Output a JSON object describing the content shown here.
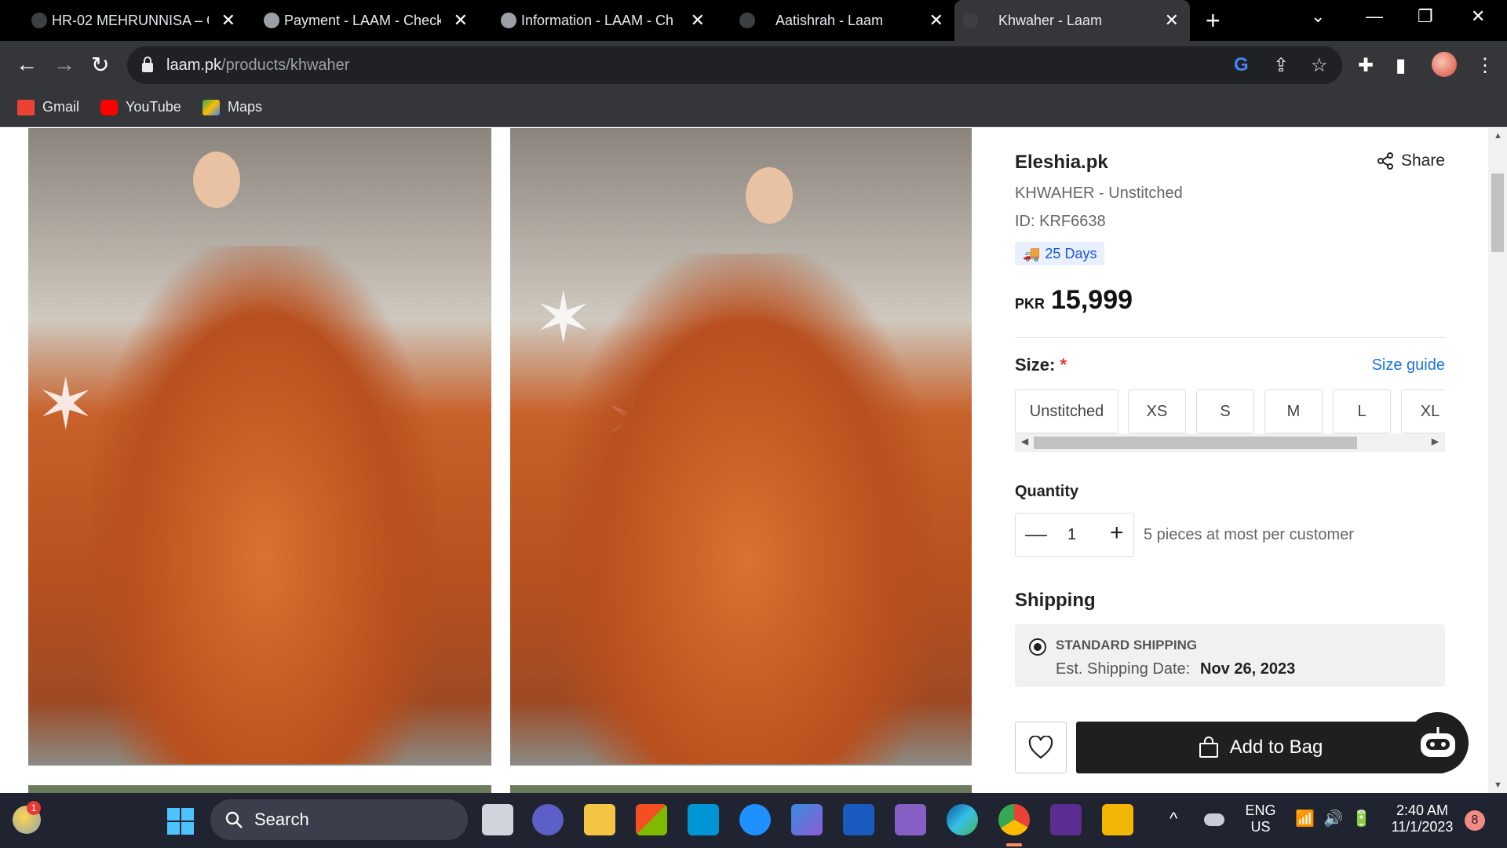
{
  "browser": {
    "tabs": [
      {
        "title": "HR-02 MEHRUNNISA – C",
        "color": "#3c4043"
      },
      {
        "title": "Payment - LAAM - Check",
        "color": "#5f6368"
      },
      {
        "title": "Information - LAAM - Ch",
        "color": "#5f6368"
      },
      {
        "title": "Aatishrah - Laam",
        "color": "#3c4043"
      },
      {
        "title": "Khwaher - Laam",
        "color": "#3c4043"
      }
    ],
    "tab_close": "✕",
    "new_tab": "+",
    "url_host": "laam.pk",
    "url_path": "/products/khwaher",
    "bookmarks": [
      {
        "label": "Gmail",
        "icon": "gmail-icon",
        "color": "#ea4335"
      },
      {
        "label": "YouTube",
        "icon": "youtube-icon",
        "color": "#ff0000"
      },
      {
        "label": "Maps",
        "icon": "maps-icon",
        "color": "#34a853"
      }
    ]
  },
  "product": {
    "brand": "Eleshia.pk",
    "share_label": "Share",
    "subtitle": "KHWAHER - Unstitched",
    "id_text": "ID: KRF6638",
    "delivery_badge": "25 Days",
    "currency": "PKR",
    "price": "15,999",
    "size_label": "Size:",
    "required_mark": "*",
    "size_guide": "Size guide",
    "sizes": [
      "Unstitched",
      "XS",
      "S",
      "M",
      "L",
      "XL"
    ],
    "quantity_label": "Quantity",
    "quantity_value": "1",
    "quantity_note": "5 pieces at most per customer",
    "shipping_label": "Shipping",
    "shipping_option": "STANDARD SHIPPING",
    "shipping_date_label": "Est. Shipping Date:",
    "shipping_date": "Nov 26, 2023",
    "add_to_bag": "Add to Bag"
  },
  "taskbar": {
    "search_placeholder": "Search",
    "weather_badge": "1",
    "lang_top": "ENG",
    "lang_bottom": "US",
    "time": "2:40 AM",
    "date": "11/1/2023",
    "notification_count": "8"
  },
  "colors": {
    "accent_link": "#1a73e8",
    "button_dark": "#1f1f1f",
    "required": "#e53935"
  }
}
